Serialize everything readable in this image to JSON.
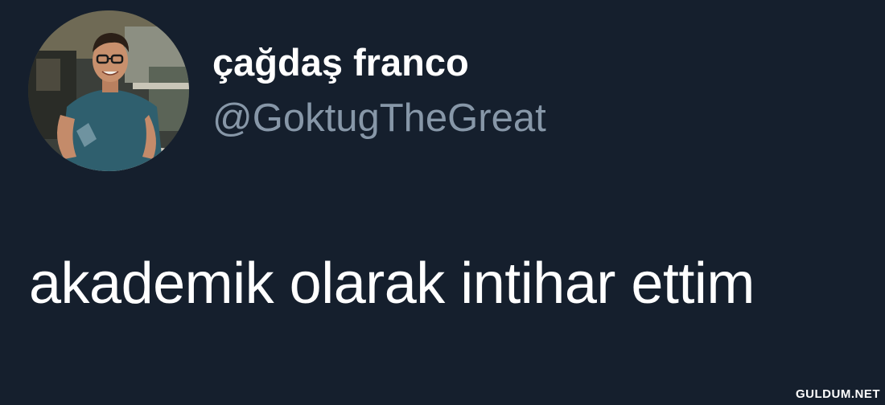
{
  "user": {
    "display_name": "çağdaş franco",
    "handle": "@GoktugTheGreat",
    "avatar_icon": "profile-photo"
  },
  "tweet": {
    "text": "akademik olarak intihar ettim"
  },
  "watermark": "GULDUM.NET",
  "colors": {
    "background": "#151f2d",
    "name": "#ffffff",
    "handle": "#8797a8",
    "text": "#ffffff"
  }
}
